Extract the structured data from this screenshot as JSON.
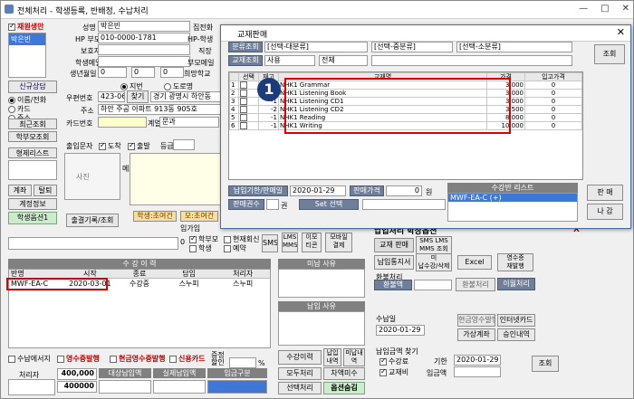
{
  "window": {
    "title": "전체처리 - 학생등록, 반배정, 수납처리",
    "controls": [
      "—",
      "□",
      "✕"
    ]
  },
  "left": {
    "student_type_label": "재원생만",
    "student_name": "박은빈",
    "new_consult": "신규상담",
    "radio": [
      "이름/전화",
      "카드",
      "주소"
    ],
    "recent": "최근조회",
    "parent_lookup": "학부모조회",
    "siblings": "형제리스트",
    "btn_account": "계좌",
    "btn_withdraw": "탈퇴",
    "btn_settle": "계정정보",
    "btn_option": "학생옵션1",
    "btn_attend": "출결기록/조회"
  },
  "form": {
    "name_label": "성명",
    "name_value": "박은빈",
    "hp_label": "HP 부모",
    "hp_value": "010-0000-1781",
    "guardian_label": "보호자",
    "student_email_label": "학생메일",
    "birth_label": "생년월일",
    "birth_m": "0",
    "birth_d": "0",
    "birth_y": "0",
    "home_phone_label": "집전화",
    "hp_student_label": "HP-학생",
    "work_label": "직장",
    "parent_email_label": "부모메일",
    "hope_school_label": "희망학교",
    "lunar": "지번",
    "road": "도로명",
    "zip_label": "우편번호",
    "zip_value": "423-060",
    "find": "찾기",
    "zip_addr": "경기 광명시 하안동",
    "addr_label": "주소",
    "addr_value": "하안 주공 아파트 913동 905호",
    "card_label": "카드번호",
    "school_label": "계열",
    "school_value": "문과",
    "password_label": "암호",
    "outing_label": "출입문자",
    "arrive": "도착",
    "depart": "출발",
    "grade_label": "등급",
    "student_memo_label": "학생상담",
    "photo": "사진",
    "memo_label": "메모",
    "init_btn": "학생:초여건",
    "parent_init_btn": "모:초여건",
    "join_label": "입가입"
  },
  "options": {
    "parent_sms": "학부모",
    "student_sms": "학생",
    "current_class": "현재회신",
    "reserve": "예약",
    "sms": "SMS",
    "lms": "LMS\nMMS",
    "emoticon": "이모\n티콘",
    "mobile": "모바일\n결제"
  },
  "history": {
    "title": "수 강 이 력",
    "cols": [
      "반명",
      "시작",
      "종료",
      "담임",
      "처리자"
    ],
    "rows": [
      [
        "MWF-EA-C",
        "2020-03-01",
        "수강중",
        "스누피",
        "스누피"
      ]
    ]
  },
  "unpaid": {
    "title": "미납 사유",
    "paid_title": "납입 사유"
  },
  "bottom": {
    "no_receipt": "수납에서지",
    "receipt_issue": "영수증발행",
    "cash_receipt": "현금영수증발행",
    "card_pay": "신용카드",
    "discount": "증정할인",
    "percent": "%",
    "payer_label": "처리자",
    "amount1": "400,000",
    "amount2": "400000",
    "tabs": [
      "대상납입액",
      "실제납입액",
      "입금구분"
    ],
    "history_btn": "수강이력",
    "unpaid_btn": "납입내역",
    "unpaid_detail": "미납내역",
    "all_process": "모두처리",
    "balance": "차액미수",
    "select_process": "선택처리",
    "option_price": "옵션숨김"
  },
  "pay": {
    "title": "납입처리 학장옵션",
    "textbook": "교재 판매",
    "sms_lms": "SMS LMS\nMMS 조회",
    "notice": "납입통지서",
    "unpaid_btn": "미\n납수강/삭제",
    "excel": "Excel",
    "receipt": "영수증\n재발행",
    "refund_label": "환불처리",
    "refund_amt": "환불액",
    "refund_btn": "환불처리",
    "transfer": "이월처리",
    "paid_date_label": "수납일",
    "paid_date": "2020-01-29",
    "cash_receipt_btn": "현금영수발행",
    "internet_card": "인터넷카드",
    "virtual_account": "가상계좌",
    "approval": "승인내역",
    "search_label": "납입금액 찾기",
    "fee": "수강료",
    "textbook_fee": "교재비",
    "period_label": "기한",
    "period_value": "2020-01-29",
    "deposit_label": "입금액",
    "search_btn": "조회"
  },
  "dialog": {
    "title": "교재판매",
    "cat_label": "분류조회",
    "cat1": "[선택-대분류]",
    "cat2": "[선택-중분류]",
    "cat3": "[선택-소분류]",
    "book_label": "교재조회",
    "use": "사용",
    "all": "전체",
    "search_btn": "조회",
    "cols": [
      "선택",
      "재고",
      "교재명",
      "가격",
      "입고가격"
    ],
    "rows": [
      [
        "1",
        "",
        "NHK1 Grammar",
        "3,000",
        "0"
      ],
      [
        "2",
        "-1",
        "NHK1 Listening Book",
        "3,000",
        "0"
      ],
      [
        "3",
        "-1",
        "NHK1 Listening CD1",
        "3,000",
        "0"
      ],
      [
        "4",
        "-2",
        "NHK1 Listening CD2",
        "3,500",
        "0"
      ],
      [
        "5",
        "-1",
        "NHK1 Reading",
        "8,000",
        "0"
      ],
      [
        "6",
        "-1",
        "NHK1 Writing",
        "10,000",
        "0"
      ]
    ],
    "paydate_label": "납입기한/판매일",
    "paydate": "2020-01-29",
    "total_label": "판매가격",
    "total": "0",
    "won": "원",
    "count_label": "판매권수",
    "count_unit": "권",
    "set_label": "Set 선택",
    "list_title": "수강반 리스트",
    "list_item": "MWF-EA-C (+)",
    "sell": "판 매",
    "close": "나 감",
    "callout": "1"
  }
}
